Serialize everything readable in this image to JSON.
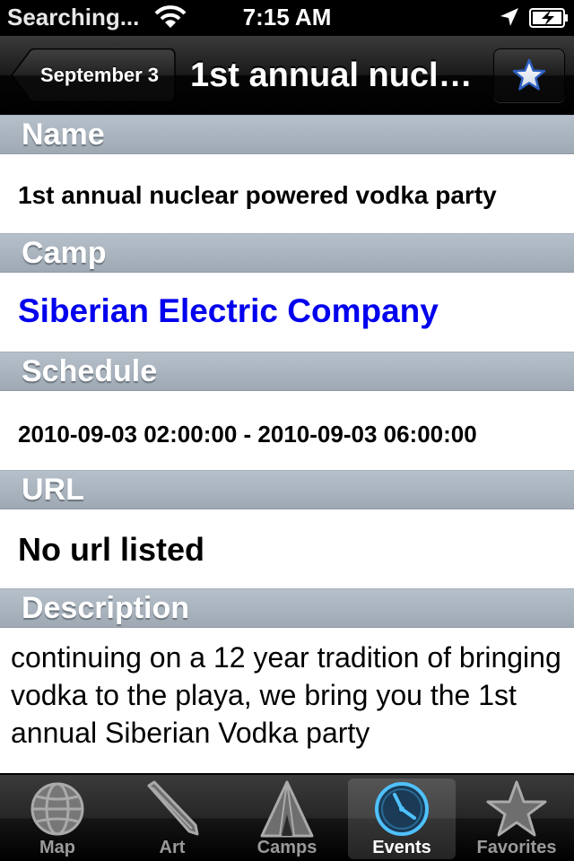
{
  "status_bar": {
    "carrier": "Searching...",
    "time": "7:15 AM"
  },
  "nav_bar": {
    "back_label": "September 3",
    "title": "1st annual nuclear powered vodka party",
    "favorite_icon": "star-icon"
  },
  "sections": {
    "name": {
      "header": "Name",
      "value": "1st annual nuclear powered vodka party"
    },
    "camp": {
      "header": "Camp",
      "value": "Siberian Electric Company",
      "link_color": "#0000ee"
    },
    "schedule": {
      "header": "Schedule",
      "value": "2010-09-03 02:00:00 - 2010-09-03 06:00:00"
    },
    "url": {
      "header": "URL",
      "value": "No url listed"
    },
    "description": {
      "header": "Description",
      "value": "continuing on a 12 year tradition of bringing vodka to the playa, we bring you the 1st annual Siberian Vodka party"
    }
  },
  "tab_bar": {
    "selected": "Events",
    "tabs": [
      {
        "label": "Map",
        "icon": "globe-icon"
      },
      {
        "label": "Art",
        "icon": "pen-icon"
      },
      {
        "label": "Camps",
        "icon": "tent-icon"
      },
      {
        "label": "Events",
        "icon": "clock-icon"
      },
      {
        "label": "Favorites",
        "icon": "star-icon"
      }
    ]
  },
  "colors": {
    "section_header": "#a8b2bd",
    "selected_tab_icon": "#4fc1ff"
  }
}
